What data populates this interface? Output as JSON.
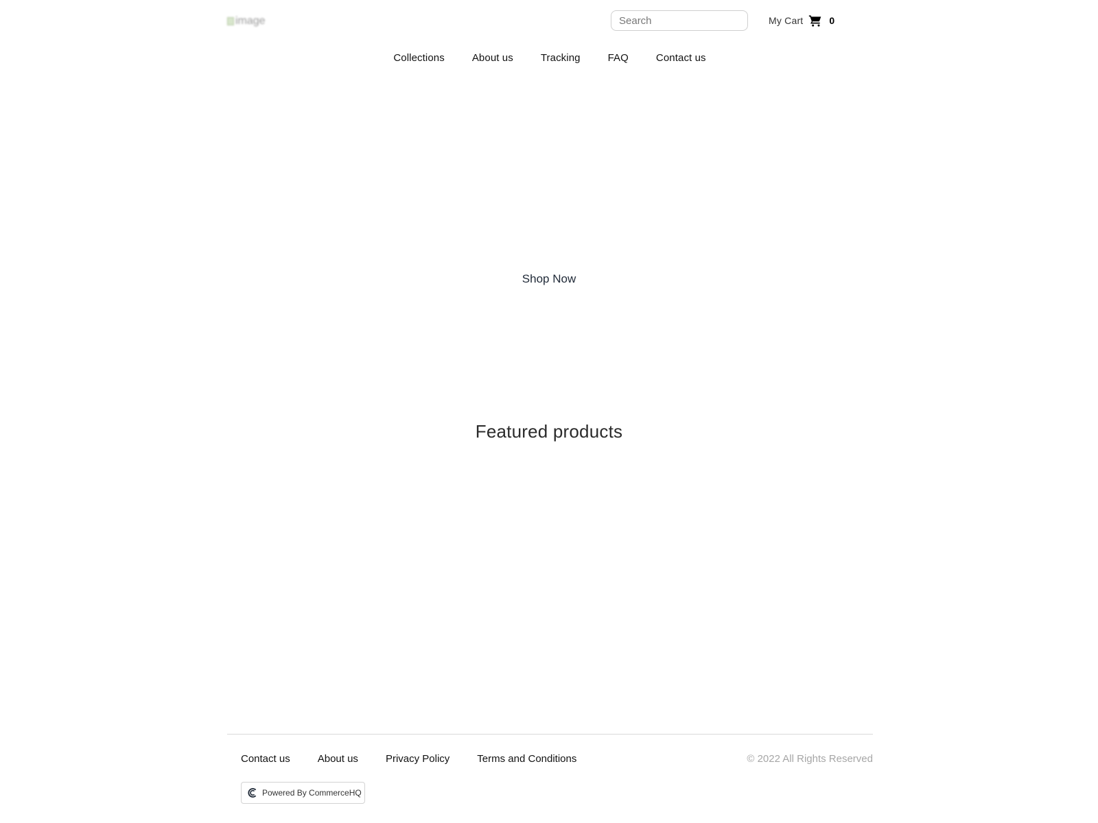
{
  "header": {
    "logo_alt": "image",
    "search": {
      "placeholder": "Search",
      "value": ""
    },
    "cart": {
      "label": "My Cart",
      "icon": "cart-icon",
      "count": "0"
    }
  },
  "nav": {
    "items": [
      {
        "label": "Collections"
      },
      {
        "label": "About us"
      },
      {
        "label": "Tracking"
      },
      {
        "label": "FAQ"
      },
      {
        "label": "Contact us"
      }
    ]
  },
  "hero": {
    "cta_label": "Shop Now"
  },
  "featured": {
    "title": "Featured products"
  },
  "footer": {
    "links": [
      {
        "label": "Contact us"
      },
      {
        "label": "About us"
      },
      {
        "label": "Privacy Policy"
      },
      {
        "label": "Terms and Conditions"
      }
    ],
    "copyright": "© 2022 All Rights Reserved",
    "powered_by": {
      "label": "Powered By CommerceHQ",
      "icon": "commercehq-logo-icon"
    }
  }
}
